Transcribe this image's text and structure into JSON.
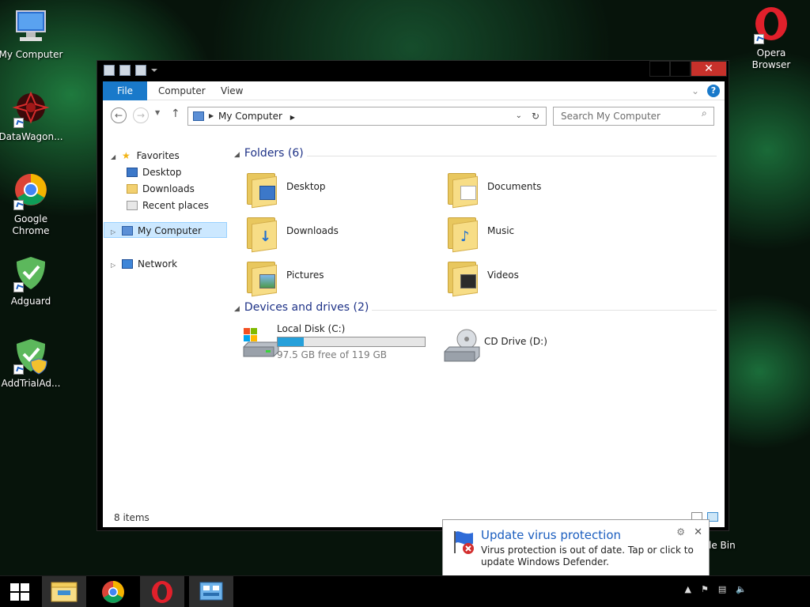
{
  "desktop": {
    "icons": [
      {
        "label": "My Computer"
      },
      {
        "label": "DataWagon..."
      },
      {
        "label": "Google Chrome"
      },
      {
        "label": "Adguard"
      },
      {
        "label": "AddTrialAd..."
      },
      {
        "label": "Opera Browser"
      }
    ],
    "recycle_bin_partial": "le Bin"
  },
  "window": {
    "ribbon_tabs": [
      {
        "label": "File"
      },
      {
        "label": "Computer"
      },
      {
        "label": "View"
      }
    ],
    "help_glyph": "?",
    "address": {
      "crumb": "My Computer"
    },
    "search": {
      "placeholder": "Search My Computer"
    },
    "nav_pane": {
      "favorites": {
        "label": "Favorites",
        "items": [
          {
            "label": "Desktop"
          },
          {
            "label": "Downloads"
          },
          {
            "label": "Recent places"
          }
        ]
      },
      "computer": {
        "label": "My Computer"
      },
      "network": {
        "label": "Network"
      }
    },
    "folders_group": {
      "header": "Folders (6)"
    },
    "folders": [
      {
        "label": "Desktop"
      },
      {
        "label": "Documents"
      },
      {
        "label": "Downloads"
      },
      {
        "label": "Music"
      },
      {
        "label": "Pictures"
      },
      {
        "label": "Videos"
      }
    ],
    "devices_group": {
      "header": "Devices and drives (2)"
    },
    "drives": [
      {
        "label": "Local Disk (C:)",
        "free_text": "97.5 GB free of 119 GB",
        "used_fraction": 0.18
      },
      {
        "label": "CD Drive (D:)"
      }
    ],
    "status": {
      "items": "8 items"
    }
  },
  "toast": {
    "title": "Update virus protection",
    "body": "Virus protection is out of date. Tap or click to update Windows Defender."
  },
  "colors": {
    "accent": "#1979ca",
    "title_red": "#c7312b",
    "folder": "#f7dd86"
  }
}
